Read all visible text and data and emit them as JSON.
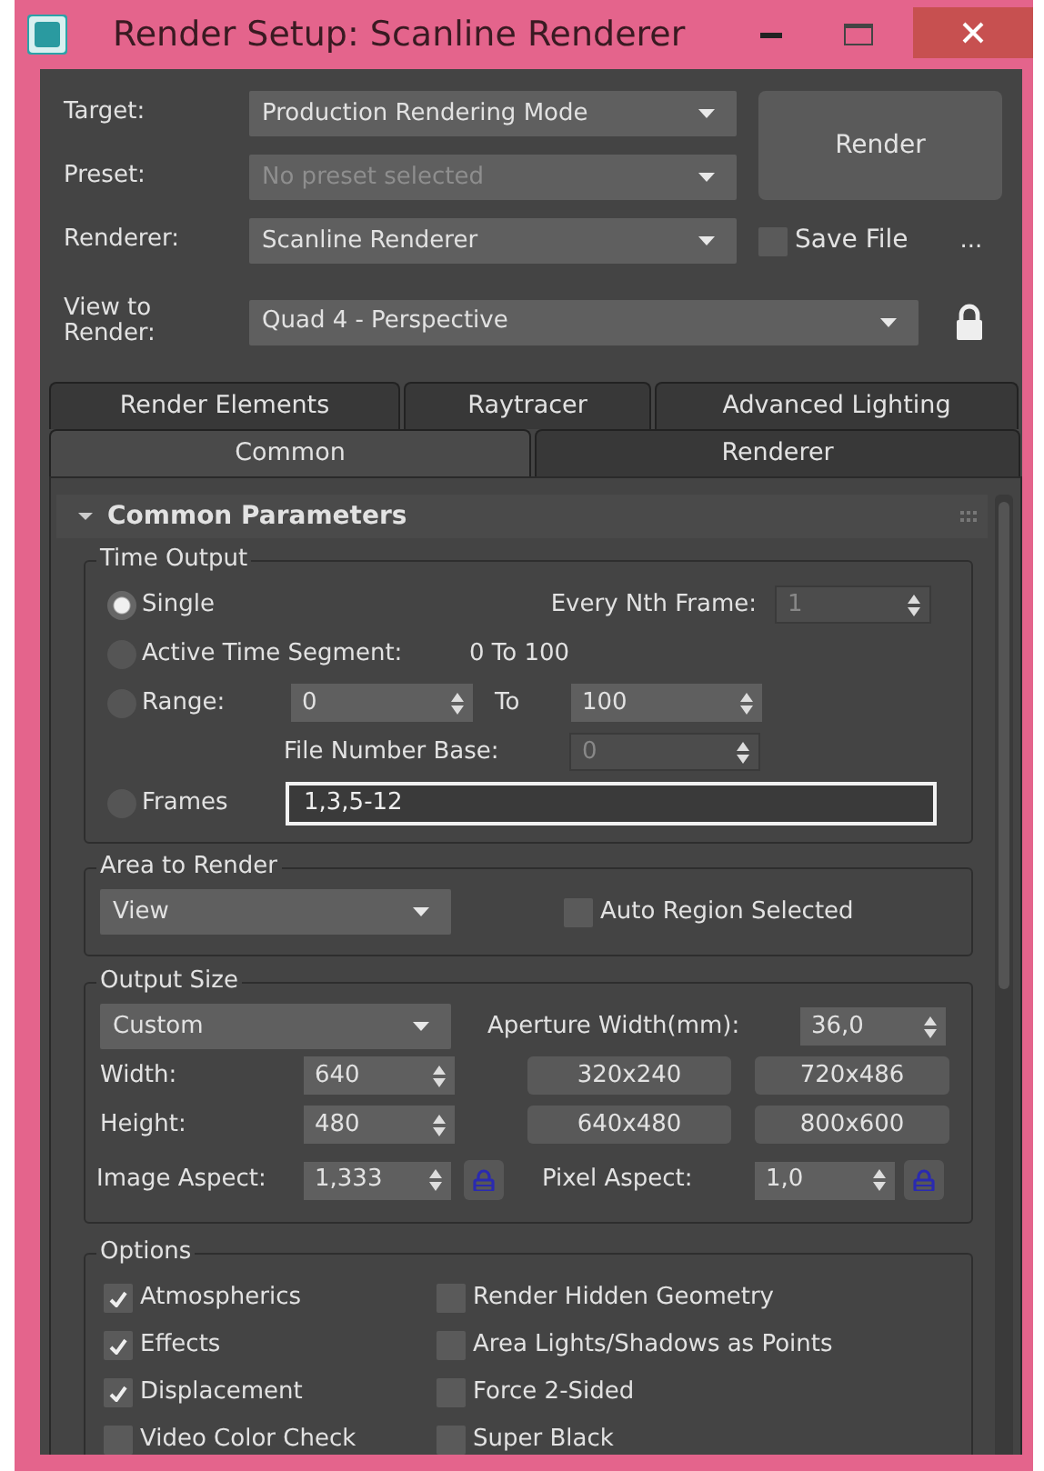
{
  "window": {
    "title": "Render Setup: Scanline Renderer"
  },
  "header": {
    "target": {
      "label": "Target:",
      "value": "Production Rendering Mode"
    },
    "preset": {
      "label": "Preset:",
      "placeholder": "No preset selected",
      "disabled": true
    },
    "renderer": {
      "label": "Renderer:",
      "value": "Scanline Renderer"
    },
    "view_to_render": {
      "label": "View to Render:",
      "value": "Quad 4 - Perspective"
    },
    "render_button": "Render",
    "save_file": {
      "label": "Save File",
      "checked": false
    },
    "more_button": "..."
  },
  "tab_rows": [
    {
      "tabs": [
        {
          "label": "Render Elements",
          "selected": false
        },
        {
          "label": "Raytracer",
          "selected": false
        },
        {
          "label": "Advanced Lighting",
          "selected": false
        }
      ]
    },
    {
      "tabs": [
        {
          "label": "Common",
          "selected": true
        },
        {
          "label": "Renderer",
          "selected": false
        }
      ]
    }
  ],
  "rollout": {
    "title": "Common Parameters",
    "expanded": true,
    "time_output": {
      "title": "Time Output",
      "every_nth_frame": {
        "label": "Every Nth Frame:",
        "value": "1",
        "disabled": true
      },
      "options": [
        {
          "kind": "single",
          "label": "Single",
          "selected": true
        },
        {
          "kind": "segment",
          "label": "Active Time Segment:",
          "value": "0 To 100",
          "selected": false
        },
        {
          "kind": "range",
          "label": "Range:",
          "from": "0",
          "to_label": "To",
          "to": "100",
          "selected": false,
          "file_number_base": {
            "label": "File Number Base:",
            "value": "0",
            "disabled": true
          }
        },
        {
          "kind": "frames",
          "label": "Frames",
          "value": "1,3,5-12",
          "selected": false
        }
      ]
    },
    "area_to_render": {
      "title": "Area to Render",
      "value": "View",
      "auto_region": {
        "label": "Auto Region Selected",
        "checked": false
      }
    },
    "output_size": {
      "title": "Output Size",
      "preset": "Custom",
      "aperture": {
        "label": "Aperture Width(mm):",
        "value": "36,0"
      },
      "width": {
        "label": "Width:",
        "value": "640"
      },
      "height": {
        "label": "Height:",
        "value": "480"
      },
      "presets": [
        "320x240",
        "720x486",
        "640x480",
        "800x600"
      ],
      "image_aspect": {
        "label": "Image Aspect:",
        "value": "1,333"
      },
      "pixel_aspect": {
        "label": "Pixel Aspect:",
        "value": "1,0"
      }
    },
    "options": {
      "title": "Options",
      "items": [
        {
          "label": "Atmospherics",
          "checked": true
        },
        {
          "label": "Render Hidden Geometry",
          "checked": false
        },
        {
          "label": "Effects",
          "checked": true
        },
        {
          "label": "Area Lights/Shadows as Points",
          "checked": false
        },
        {
          "label": "Displacement",
          "checked": true
        },
        {
          "label": "Force 2-Sided",
          "checked": false
        },
        {
          "label": "Video Color Check",
          "checked": false
        },
        {
          "label": "Super Black",
          "checked": false
        }
      ]
    }
  }
}
